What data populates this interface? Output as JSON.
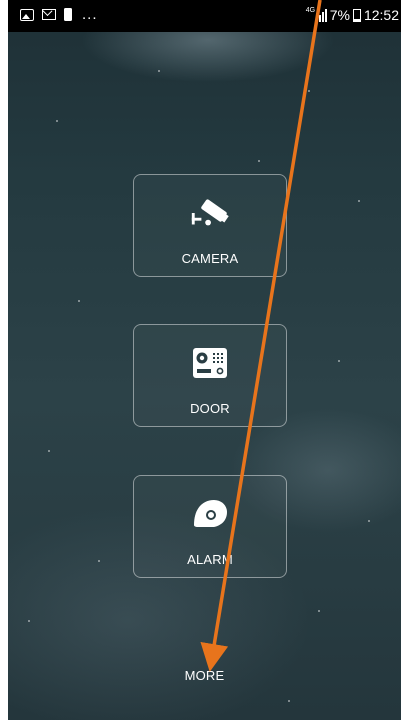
{
  "statusbar": {
    "dots": "...",
    "network": "4G",
    "battery": "7%",
    "time": "12:52",
    "left_icons": [
      "image-icon",
      "mail-icon",
      "phone-icon"
    ]
  },
  "tiles": [
    {
      "label": "CAMERA",
      "icon": "security-camera-icon"
    },
    {
      "label": "DOOR",
      "icon": "door-intercom-icon"
    },
    {
      "label": "ALARM",
      "icon": "alarm-sensor-icon"
    }
  ],
  "more": {
    "label": "MORE"
  },
  "colors": {
    "background": "#26393f",
    "annotation_arrow": "#e8741c",
    "text": "#ffffff",
    "tile_border": "rgba(255,255,255,0.45)"
  }
}
